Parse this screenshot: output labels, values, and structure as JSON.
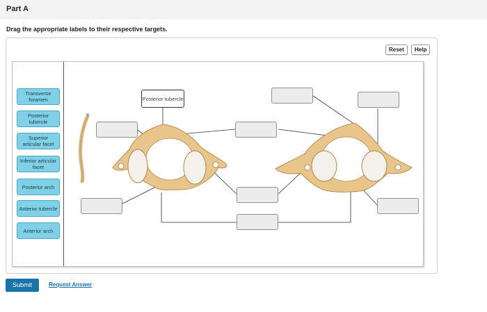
{
  "part": {
    "title": "Part A"
  },
  "instruction": "Drag the appropriate labels to their respective targets.",
  "toolbar": {
    "reset_label": "Reset",
    "help_label": "Help"
  },
  "labels": [
    "Transverse foramen",
    "Posterior tubercle",
    "Superior articular facet",
    "Inferior articular facet",
    "Posterior arch",
    "Anterior tubercle",
    "Anterior arch"
  ],
  "placed_label": "Posterior tubercle",
  "footer": {
    "submit_label": "Submit",
    "request_label": "Request Answer"
  },
  "colors": {
    "label_fill": "#80d0e8",
    "bone": "#e8c58a",
    "submit": "#1a73a8"
  }
}
